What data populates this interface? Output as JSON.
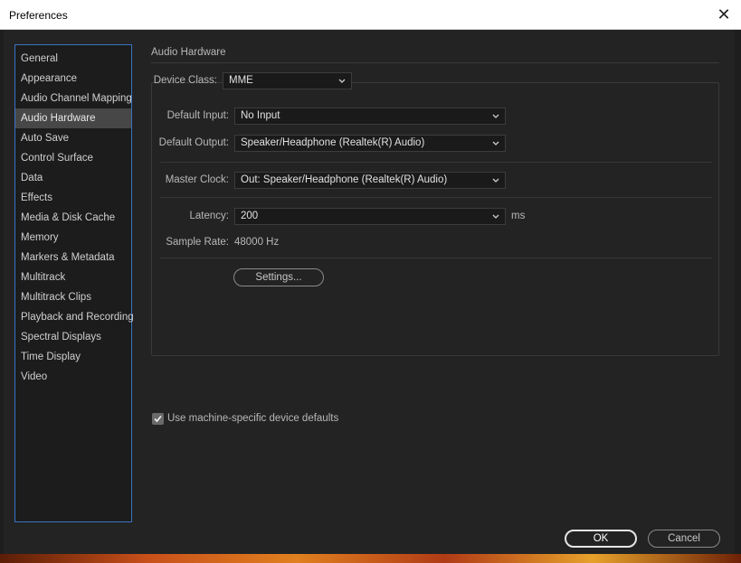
{
  "window": {
    "title": "Preferences",
    "close_glyph": "✕"
  },
  "sidebar": {
    "items": [
      {
        "label": "General"
      },
      {
        "label": "Appearance"
      },
      {
        "label": "Audio Channel Mapping"
      },
      {
        "label": "Audio Hardware",
        "selected": true
      },
      {
        "label": "Auto Save"
      },
      {
        "label": "Control Surface"
      },
      {
        "label": "Data"
      },
      {
        "label": "Effects"
      },
      {
        "label": "Media & Disk Cache"
      },
      {
        "label": "Memory"
      },
      {
        "label": "Markers & Metadata"
      },
      {
        "label": "Multitrack"
      },
      {
        "label": "Multitrack Clips"
      },
      {
        "label": "Playback and Recording"
      },
      {
        "label": "Spectral Displays"
      },
      {
        "label": "Time Display"
      },
      {
        "label": "Video"
      }
    ]
  },
  "main": {
    "section_title": "Audio Hardware",
    "device_class": {
      "label": "Device Class:",
      "value": "MME"
    },
    "default_input": {
      "label": "Default Input:",
      "value": "No Input"
    },
    "default_output": {
      "label": "Default Output:",
      "value": "Speaker/Headphone (Realtek(R) Audio)"
    },
    "master_clock": {
      "label": "Master Clock:",
      "value": "Out: Speaker/Headphone (Realtek(R) Audio)"
    },
    "latency": {
      "label": "Latency:",
      "value": "200",
      "unit": "ms"
    },
    "sample_rate": {
      "label": "Sample Rate:",
      "value": "48000 Hz"
    },
    "settings_button": "Settings...",
    "machine_defaults": {
      "label": "Use machine-specific device defaults",
      "checked": true
    }
  },
  "footer": {
    "ok": "OK",
    "cancel": "Cancel"
  },
  "colors": {
    "accent_border": "#3a73c4",
    "selected_item_bg": "#474747",
    "dialog_bg": "#232323"
  },
  "icons": {
    "close": "close-icon",
    "dropdown": "chevron-down-icon",
    "check": "checkmark-icon"
  }
}
